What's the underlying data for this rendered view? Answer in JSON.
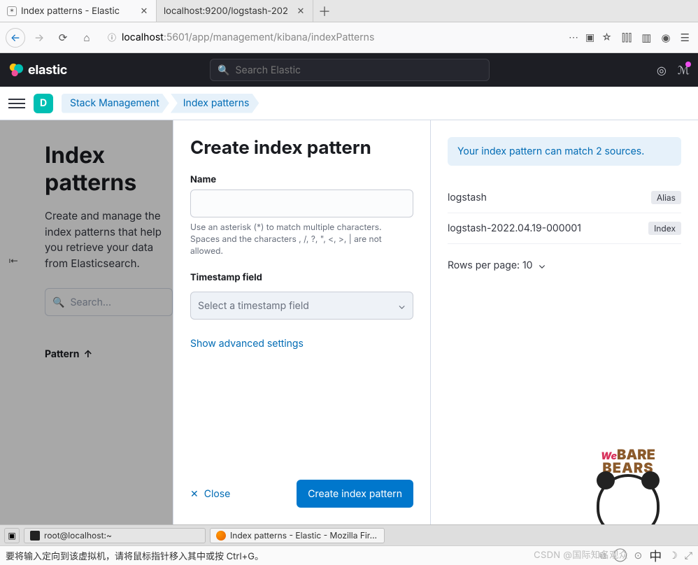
{
  "browser": {
    "tabs": [
      {
        "title": "Index patterns - Elastic"
      },
      {
        "title": "localhost:9200/logstash-202"
      }
    ],
    "url_host": "localhost",
    "url_path": ":5601/app/management/kibana/indexPatterns"
  },
  "elastic": {
    "brand": "elastic",
    "search_placeholder": "Search Elastic"
  },
  "breadcrumbs": {
    "avatar_initial": "D",
    "items": [
      "Stack Management",
      "Index patterns"
    ]
  },
  "background_page": {
    "title": "Index patterns",
    "subtitle": "Create and manage the index patterns that help you retrieve your data from Elasticsearch.",
    "search_placeholder": "Search...",
    "column_header": "Pattern"
  },
  "flyout": {
    "title": "Create index pattern",
    "name_label": "Name",
    "name_help": "Use an asterisk (*) to match multiple characters. Spaces and the characters , /, ?, \", <, >, | are not allowed.",
    "ts_label": "Timestamp field",
    "ts_placeholder": "Select a timestamp field",
    "advanced_link": "Show advanced settings",
    "close_label": "Close",
    "submit_label": "Create index pattern",
    "callout": "Your index pattern can match 2 sources.",
    "matches": [
      {
        "name": "logstash",
        "badge": "Alias"
      },
      {
        "name": "logstash-2022.04.19-000001",
        "badge": "Index"
      }
    ],
    "rows_per_page_label": "Rows per page: 10"
  },
  "taskbar": {
    "terminal": "root@localhost:~",
    "firefox": "Index patterns - Elastic - Mozilla Fir…"
  },
  "vmstatus": {
    "text": "要将输入定向到该虚拟机，请将鼠标指针移入其中或按 Ctrl+G。",
    "watermark": "CSDN @国际知名观众",
    "ime": "中"
  }
}
